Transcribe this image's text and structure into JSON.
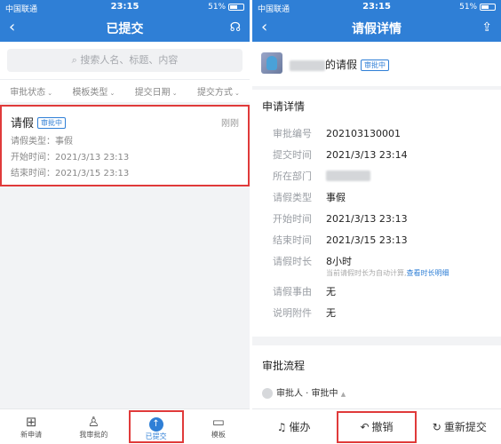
{
  "status_bar": {
    "carrier": "中国联通",
    "time": "23:15",
    "battery": "51%"
  },
  "left": {
    "title": "已提交",
    "search_placeholder": "搜索人名、标题、内容",
    "filters": [
      "审批状态",
      "模板类型",
      "提交日期",
      "提交方式"
    ],
    "card": {
      "title": "请假",
      "badge": "审批中",
      "time": "刚刚",
      "rows": [
        "请假类型：事假",
        "开始时间：2021/3/13 23:13",
        "结束时间：2021/3/15 23:13"
      ]
    },
    "tabs": [
      {
        "label": "新申请",
        "icon": "new-request-icon"
      },
      {
        "label": "我审批的",
        "icon": "stamp-icon"
      },
      {
        "label": "已提交",
        "icon": "submitted-icon"
      },
      {
        "label": "模板",
        "icon": "template-icon"
      }
    ]
  },
  "right": {
    "title": "请假详情",
    "name_suffix": "的请假",
    "badge": "审批中",
    "section_title": "申请详情",
    "fields": [
      {
        "k": "审批编号",
        "v": "202103130001"
      },
      {
        "k": "提交时间",
        "v": "2021/3/13 23:14"
      },
      {
        "k": "所在部门",
        "v": ""
      },
      {
        "k": "请假类型",
        "v": "事假"
      },
      {
        "k": "开始时间",
        "v": "2021/3/13 23:13"
      },
      {
        "k": "结束时间",
        "v": "2021/3/15 23:13"
      },
      {
        "k": "请假时长",
        "v": "8小时"
      }
    ],
    "duration_note": "当前请假时长为自动计算,",
    "duration_link": "查看时长明细",
    "fields2": [
      {
        "k": "请假事由",
        "v": "无"
      },
      {
        "k": "说明附件",
        "v": "无"
      }
    ],
    "flow_title": "审批流程",
    "approver": "审批人 · 审批中",
    "actions": {
      "remind": "催办",
      "revoke": "撤销",
      "resubmit": "重新提交"
    }
  },
  "colors": {
    "brand": "#2f7fd6",
    "highlight": "#e03a3a"
  }
}
